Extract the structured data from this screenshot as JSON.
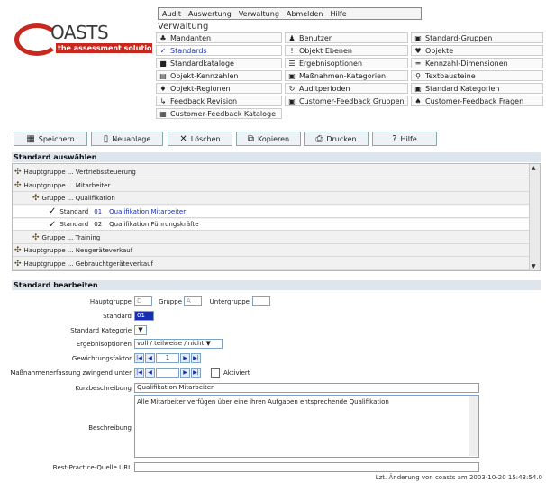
{
  "logo": {
    "main": "OASTS",
    "tagline": "the assessment solution"
  },
  "menu": [
    "Audit",
    "Auswertung",
    "Verwaltung",
    "Abmelden",
    "Hilfe"
  ],
  "nav_title": "Verwaltung",
  "nav": [
    {
      "icon": "mandanten-icon",
      "glyph": "♣",
      "label": "Mandanten"
    },
    {
      "icon": "benutzer-icon",
      "glyph": "♟",
      "label": "Benutzer"
    },
    {
      "icon": "standard-gruppen-icon",
      "glyph": "▣",
      "label": "Standard-Gruppen"
    },
    {
      "icon": "check-icon",
      "glyph": "✓",
      "label": "Standards",
      "active": true
    },
    {
      "icon": "objekt-ebenen-icon",
      "glyph": "!",
      "label": "Objekt Ebenen"
    },
    {
      "icon": "objekte-icon",
      "glyph": "♥",
      "label": "Objekte"
    },
    {
      "icon": "standardkataloge-icon",
      "glyph": "■",
      "label": "Standardkataloge"
    },
    {
      "icon": "ergebnisoptionen-icon",
      "glyph": "☰",
      "label": "Ergebnisoptionen"
    },
    {
      "icon": "kennzahl-dimensionen-icon",
      "glyph": "═",
      "label": "Kennzahl-Dimensionen"
    },
    {
      "icon": "objekt-kennzahlen-icon",
      "glyph": "▤",
      "label": "Objekt-Kennzahlen"
    },
    {
      "icon": "massnahmen-kategorien-icon",
      "glyph": "▣",
      "label": "Maßnahmen-Kategorien"
    },
    {
      "icon": "textbausteine-icon",
      "glyph": "⚲",
      "label": "Textbausteine"
    },
    {
      "icon": "objekt-regionen-icon",
      "glyph": "♦",
      "label": "Objekt-Regionen"
    },
    {
      "icon": "auditperioden-icon",
      "glyph": "↻",
      "label": "Auditperioden"
    },
    {
      "icon": "standard-kategorien-icon",
      "glyph": "▣",
      "label": "Standard Kategorien"
    },
    {
      "icon": "feedback-revision-icon",
      "glyph": "↳",
      "label": "Feedback Revision"
    },
    {
      "icon": "feedback-gruppen-icon",
      "glyph": "▣",
      "label": "Customer-Feedback Gruppen"
    },
    {
      "icon": "feedback-fragen-icon",
      "glyph": "♠",
      "label": "Customer-Feedback Fragen"
    },
    {
      "icon": "feedback-kataloge-icon",
      "glyph": "▦",
      "label": "Customer-Feedback Kataloge"
    }
  ],
  "toolbar": [
    {
      "icon": "save-icon",
      "glyph": "▦",
      "label": "Speichern"
    },
    {
      "icon": "new-icon",
      "glyph": "▯",
      "label": "Neuanlage"
    },
    {
      "icon": "delete-icon",
      "glyph": "✕",
      "label": "Löschen"
    },
    {
      "icon": "copy-icon",
      "glyph": "⧉",
      "label": "Kopieren"
    },
    {
      "icon": "print-icon",
      "glyph": "⎙",
      "label": "Drucken"
    },
    {
      "icon": "help-icon",
      "glyph": "?",
      "label": "Hilfe"
    }
  ],
  "select_section": "Standard auswählen",
  "tree": [
    {
      "kind": "group",
      "level": 0,
      "text": "Hauptgruppe ... Vertriebssteuerung"
    },
    {
      "kind": "group",
      "level": 0,
      "text": "Hauptgruppe ... Mitarbeiter"
    },
    {
      "kind": "group",
      "level": 1,
      "text": "Gruppe ... Qualifikation"
    },
    {
      "kind": "std",
      "level": 2,
      "prefix": "Standard",
      "num": "01",
      "text": "Qualifikation Mitarbeiter",
      "selected": true
    },
    {
      "kind": "std",
      "level": 2,
      "prefix": "Standard",
      "num": "02",
      "text": "Qualifikation Führungskräfte"
    },
    {
      "kind": "group",
      "level": 1,
      "text": "Gruppe ... Training"
    },
    {
      "kind": "group",
      "level": 0,
      "text": "Hauptgruppe ... Neugeräteverkauf"
    },
    {
      "kind": "group",
      "level": 0,
      "text": "Hauptgruppe ... Gebrauchtgeräteverkauf"
    }
  ],
  "edit_section": "Standard bearbeiten",
  "form": {
    "hauptgruppe_label": "Hauptgruppe",
    "hauptgruppe": "D",
    "gruppe_label": "Gruppe",
    "gruppe": "A",
    "untergruppe_label": "Untergruppe",
    "untergruppe": "",
    "standard_label": "Standard",
    "standard": "01",
    "kategorie_label": "Standard Kategorie",
    "ergebnis_label": "Ergebnisoptionen",
    "ergebnis": "voll / teilweise / nicht",
    "gewicht_label": "Gewichtungsfaktor",
    "gewicht": "1",
    "massnahme_label": "Maßnahmenerfassung zwingend unter",
    "aktiviert": "Aktiviert",
    "kurz_label": "Kurzbeschreibung",
    "kurz": "Qualifikation Mitarbeiter",
    "beschr_label": "Beschreibung",
    "beschr": "Alle Mitarbeiter verfügen über eine ihren Aufgaben entsprechende Qualifikation",
    "url_label": "Best-Practice-Quelle URL",
    "url": ""
  },
  "footer": "Lzt. Änderung von coasts am 2003-10-20 15:43:54.0",
  "colors": {
    "brand_red": "#c8281e",
    "link_blue": "#1a2fb0",
    "section": "#dde6ee"
  }
}
